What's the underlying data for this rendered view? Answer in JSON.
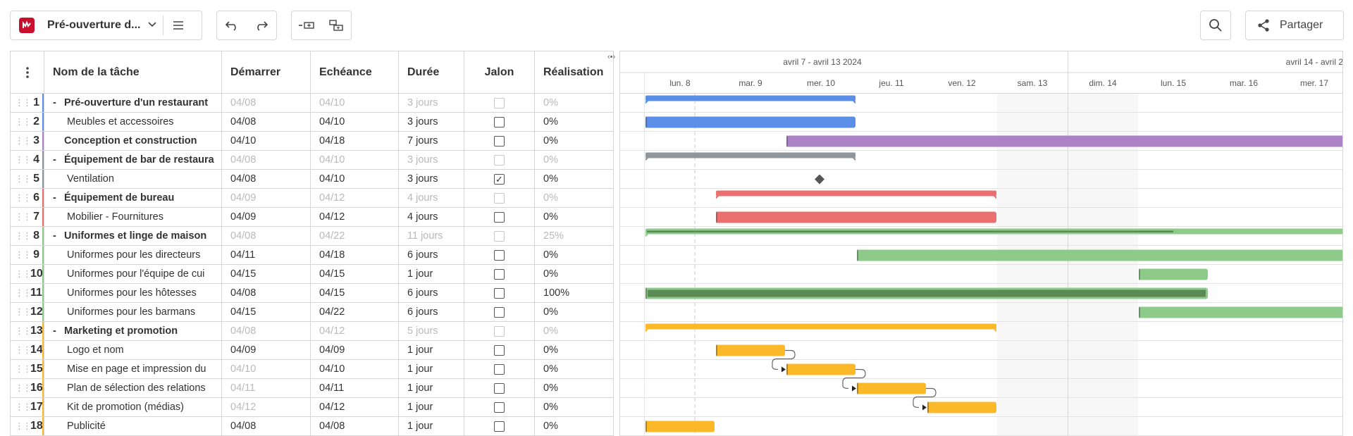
{
  "toolbar": {
    "project_name": "Pré-ouverture d...",
    "share_label": "Partager",
    "icons": [
      "app-logo-icon",
      "chevron-down-icon",
      "menu-icon",
      "undo-icon",
      "redo-icon",
      "insert-task-icon",
      "insert-subtask-icon",
      "search-icon",
      "share-icon"
    ]
  },
  "colors": {
    "blue": "#5b8ee6",
    "purple": "#ab82c5",
    "gray": "#8e959b",
    "red": "#eb6f6f",
    "green": "#8ecb8a",
    "darkgreen": "#5a8a56",
    "yellow": "#fbb829",
    "brand": "#c8102e"
  },
  "columns": {
    "name": "Nom de la tâche",
    "start": "Démarrer",
    "end": "Echéance",
    "duration": "Durée",
    "milestone": "Jalon",
    "completion": "Réalisation"
  },
  "tasks": [
    {
      "num": "1",
      "name": "Pré-ouverture d'un restaurant",
      "start": "04/08",
      "end": "04/10",
      "duration": "3 jours",
      "milestone": false,
      "completion": "0%",
      "level": 0,
      "summary": true,
      "color": "blue"
    },
    {
      "num": "2",
      "name": "Meubles et accessoires",
      "start": "04/08",
      "end": "04/10",
      "duration": "3 jours",
      "milestone": false,
      "completion": "0%",
      "level": 1,
      "summary": false,
      "color": "blue"
    },
    {
      "num": "3",
      "name": "Conception et construction",
      "start": "04/10",
      "end": "04/18",
      "duration": "7 jours",
      "milestone": false,
      "completion": "0%",
      "level": 0,
      "summary": false,
      "bold": true,
      "color": "purple"
    },
    {
      "num": "4",
      "name": "Équipement de bar de restaura",
      "start": "04/08",
      "end": "04/10",
      "duration": "3 jours",
      "milestone": false,
      "completion": "0%",
      "level": 0,
      "summary": true,
      "color": "gray"
    },
    {
      "num": "5",
      "name": "Ventilation",
      "start": "04/08",
      "end": "04/10",
      "duration": "3 jours",
      "milestone": true,
      "completion": "0%",
      "level": 1,
      "summary": false,
      "color": "gray"
    },
    {
      "num": "6",
      "name": "Équipement de bureau",
      "start": "04/09",
      "end": "04/12",
      "duration": "4 jours",
      "milestone": false,
      "completion": "0%",
      "level": 0,
      "summary": true,
      "color": "red"
    },
    {
      "num": "7",
      "name": "Mobilier - Fournitures",
      "start": "04/09",
      "end": "04/12",
      "duration": "4 jours",
      "milestone": false,
      "completion": "0%",
      "level": 1,
      "summary": false,
      "color": "red"
    },
    {
      "num": "8",
      "name": "Uniformes et linge de maison",
      "start": "04/08",
      "end": "04/22",
      "duration": "11 jours",
      "milestone": false,
      "completion": "25%",
      "level": 0,
      "summary": true,
      "color": "green"
    },
    {
      "num": "9",
      "name": "Uniformes pour les directeurs",
      "start": "04/11",
      "end": "04/18",
      "duration": "6 jours",
      "milestone": false,
      "completion": "0%",
      "level": 1,
      "summary": false,
      "color": "green"
    },
    {
      "num": "10",
      "name": "Uniformes pour l'équipe de cui",
      "start": "04/15",
      "end": "04/15",
      "duration": "1 jour",
      "milestone": false,
      "completion": "0%",
      "level": 1,
      "summary": false,
      "color": "green"
    },
    {
      "num": "11",
      "name": "Uniformes pour les hôtesses",
      "start": "04/08",
      "end": "04/15",
      "duration": "6 jours",
      "milestone": false,
      "completion": "100%",
      "level": 1,
      "summary": false,
      "color": "green"
    },
    {
      "num": "12",
      "name": "Uniformes pour les barmans",
      "start": "04/15",
      "end": "04/22",
      "duration": "6 jours",
      "milestone": false,
      "completion": "0%",
      "level": 1,
      "summary": false,
      "color": "green"
    },
    {
      "num": "13",
      "name": "Marketing et promotion",
      "start": "04/08",
      "end": "04/12",
      "duration": "5 jours",
      "milestone": false,
      "completion": "0%",
      "level": 0,
      "summary": true,
      "color": "yellow"
    },
    {
      "num": "14",
      "name": "Logo et nom",
      "start": "04/09",
      "end": "04/09",
      "duration": "1 jour",
      "milestone": false,
      "completion": "0%",
      "level": 1,
      "summary": false,
      "color": "yellow"
    },
    {
      "num": "15",
      "name": "Mise en page et impression du",
      "start": "04/10",
      "end": "04/10",
      "duration": "1 jour",
      "milestone": false,
      "completion": "0%",
      "level": 1,
      "summary": false,
      "color": "yellow",
      "muted_start": true
    },
    {
      "num": "16",
      "name": "Plan de sélection des relations",
      "start": "04/11",
      "end": "04/11",
      "duration": "1 jour",
      "milestone": false,
      "completion": "0%",
      "level": 1,
      "summary": false,
      "color": "yellow",
      "muted_start": true
    },
    {
      "num": "17",
      "name": "Kit de promotion (médias)",
      "start": "04/12",
      "end": "04/12",
      "duration": "1 jour",
      "milestone": false,
      "completion": "0%",
      "level": 1,
      "summary": false,
      "color": "yellow",
      "muted_start": true
    },
    {
      "num": "18",
      "name": "Publicité",
      "start": "04/08",
      "end": "04/08",
      "duration": "1 jour",
      "milestone": false,
      "completion": "0%",
      "level": 1,
      "summary": false,
      "color": "yellow"
    }
  ],
  "timeline": {
    "weeks": [
      "avril 7 - avril 13 2024",
      "avril 14 - avril 2"
    ],
    "days": [
      "lun. 8",
      "mar. 9",
      "mer. 10",
      "jeu. 11",
      "ven. 12",
      "sam. 13",
      "dim. 14",
      "lun. 15",
      "mar. 16",
      "mer. 17"
    ],
    "weekend_days": [
      "sam. 13",
      "dim. 14"
    ],
    "origin_day": 8,
    "bars": [
      {
        "row": 1,
        "start": 8,
        "end": 11,
        "color": "blue",
        "summary": true
      },
      {
        "row": 2,
        "start": 8,
        "end": 11,
        "color": "blue"
      },
      {
        "row": 3,
        "start": 10,
        "end": 19,
        "color": "purple"
      },
      {
        "row": 4,
        "start": 8,
        "end": 11,
        "color": "gray",
        "summary": true
      },
      {
        "row": 5,
        "milestone_day": 10.5,
        "color": "gray"
      },
      {
        "row": 6,
        "start": 9,
        "end": 13,
        "color": "red",
        "summary": true
      },
      {
        "row": 7,
        "start": 9,
        "end": 13,
        "color": "red"
      },
      {
        "row": 8,
        "start": 8,
        "end": 23,
        "color": "green",
        "summary": true,
        "progress": 0.25
      },
      {
        "row": 9,
        "start": 11,
        "end": 19,
        "color": "green"
      },
      {
        "row": 10,
        "start": 15,
        "end": 16,
        "color": "green"
      },
      {
        "row": 11,
        "start": 8,
        "end": 16,
        "color": "green",
        "progress": 1.0
      },
      {
        "row": 12,
        "start": 15,
        "end": 23,
        "color": "green"
      },
      {
        "row": 13,
        "start": 8,
        "end": 13,
        "color": "yellow",
        "summary": true
      },
      {
        "row": 14,
        "start": 9,
        "end": 10,
        "color": "yellow"
      },
      {
        "row": 15,
        "start": 10,
        "end": 11,
        "color": "yellow"
      },
      {
        "row": 16,
        "start": 11,
        "end": 12,
        "color": "yellow"
      },
      {
        "row": 17,
        "start": 12,
        "end": 13,
        "color": "yellow"
      },
      {
        "row": 18,
        "start": 8,
        "end": 9,
        "color": "yellow"
      }
    ],
    "links": [
      [
        14,
        15
      ],
      [
        15,
        16
      ],
      [
        16,
        17
      ]
    ]
  }
}
